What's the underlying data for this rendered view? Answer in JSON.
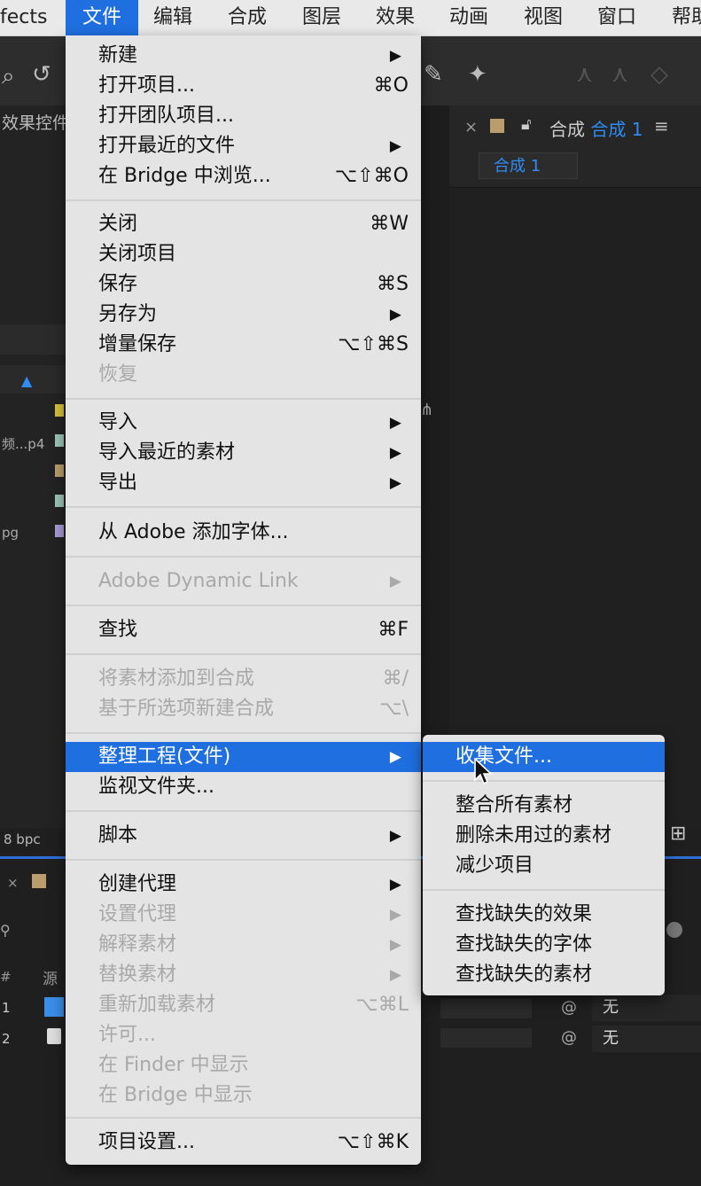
{
  "menubar": {
    "items": [
      "fects",
      "文件",
      "编辑",
      "合成",
      "图层",
      "效果",
      "动画",
      "视图",
      "窗口",
      "帮助"
    ]
  },
  "left_panel": {
    "tab_label": "效果控件",
    "rows": [
      "频...p4",
      "pg"
    ]
  },
  "comp_panel": {
    "close": "×",
    "label_prefix": "合成",
    "comp_name": "合成 1",
    "menu_icon": "≡",
    "chip": "合成 1"
  },
  "footer": {
    "bpc": "8 bpc",
    "col_hash": "#",
    "col_source": "源",
    "rows": [
      {
        "num": "1",
        "mode": "无"
      },
      {
        "num": "2",
        "mode": "无"
      }
    ]
  },
  "file_menu": {
    "items": [
      {
        "label": "新建",
        "shortcut": "",
        "submenu": true,
        "disabled": false
      },
      {
        "label": "打开项目...",
        "shortcut": "⌘O",
        "submenu": false,
        "disabled": false
      },
      {
        "label": "打开团队项目...",
        "shortcut": "",
        "submenu": false,
        "disabled": false
      },
      {
        "label": "打开最近的文件",
        "shortcut": "",
        "submenu": true,
        "disabled": false
      },
      {
        "label": "在 Bridge 中浏览...",
        "shortcut": "⌥⇧⌘O",
        "submenu": false,
        "disabled": false
      },
      {
        "label": "关闭",
        "shortcut": "⌘W",
        "submenu": false,
        "disabled": false
      },
      {
        "label": "关闭项目",
        "shortcut": "",
        "submenu": false,
        "disabled": false
      },
      {
        "label": "保存",
        "shortcut": "⌘S",
        "submenu": false,
        "disabled": false
      },
      {
        "label": "另存为",
        "shortcut": "",
        "submenu": true,
        "disabled": false
      },
      {
        "label": "增量保存",
        "shortcut": "⌥⇧⌘S",
        "submenu": false,
        "disabled": false
      },
      {
        "label": "恢复",
        "shortcut": "",
        "submenu": false,
        "disabled": true
      },
      {
        "label": "导入",
        "shortcut": "",
        "submenu": true,
        "disabled": false
      },
      {
        "label": "导入最近的素材",
        "shortcut": "",
        "submenu": true,
        "disabled": false
      },
      {
        "label": "导出",
        "shortcut": "",
        "submenu": true,
        "disabled": false
      },
      {
        "label": "从 Adobe 添加字体...",
        "shortcut": "",
        "submenu": false,
        "disabled": false
      },
      {
        "label": "Adobe Dynamic Link",
        "shortcut": "",
        "submenu": true,
        "disabled": true
      },
      {
        "label": "查找",
        "shortcut": "⌘F",
        "submenu": false,
        "disabled": false
      },
      {
        "label": "将素材添加到合成",
        "shortcut": "⌘/",
        "submenu": false,
        "disabled": true
      },
      {
        "label": "基于所选项新建合成",
        "shortcut": "⌥\\",
        "submenu": false,
        "disabled": true
      },
      {
        "label": "整理工程(文件)",
        "shortcut": "",
        "submenu": true,
        "disabled": false,
        "highlighted": true
      },
      {
        "label": "监视文件夹...",
        "shortcut": "",
        "submenu": false,
        "disabled": false
      },
      {
        "label": "脚本",
        "shortcut": "",
        "submenu": true,
        "disabled": false
      },
      {
        "label": "创建代理",
        "shortcut": "",
        "submenu": true,
        "disabled": false
      },
      {
        "label": "设置代理",
        "shortcut": "",
        "submenu": true,
        "disabled": true
      },
      {
        "label": "解释素材",
        "shortcut": "",
        "submenu": true,
        "disabled": true
      },
      {
        "label": "替换素材",
        "shortcut": "",
        "submenu": true,
        "disabled": true
      },
      {
        "label": "重新加载素材",
        "shortcut": "⌥⌘L",
        "submenu": false,
        "disabled": true
      },
      {
        "label": "许可...",
        "shortcut": "",
        "submenu": false,
        "disabled": true
      },
      {
        "label": "在 Finder 中显示",
        "shortcut": "",
        "submenu": false,
        "disabled": true
      },
      {
        "label": "在 Bridge 中显示",
        "shortcut": "",
        "submenu": false,
        "disabled": true
      },
      {
        "label": "项目设置...",
        "shortcut": "⌥⇧⌘K",
        "submenu": false,
        "disabled": false
      }
    ]
  },
  "submenu": {
    "items": [
      {
        "label": "收集文件...",
        "highlighted": true
      },
      {
        "label": "整合所有素材"
      },
      {
        "label": "删除未用过的素材"
      },
      {
        "label": "减少项目"
      },
      {
        "label": "查找缺失的效果"
      },
      {
        "label": "查找缺失的字体"
      },
      {
        "label": "查找缺失的素材"
      }
    ]
  },
  "colors": {
    "highlight": "#1f6fe0",
    "menu_bg": "#e4e4e4",
    "disabled_text": "#a9a9a9",
    "app_bg": "#1d1d1d",
    "link_blue": "#2f8cf0"
  },
  "icons": {
    "submenu_arrow": "triangle-right-icon",
    "cursor": "arrow-pointer-icon",
    "lock": "lock-icon"
  }
}
